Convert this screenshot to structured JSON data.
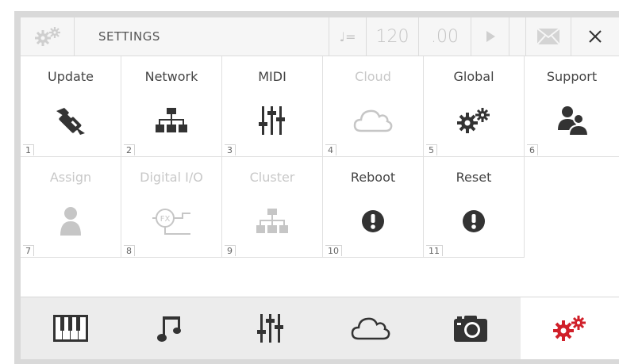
{
  "header": {
    "title": "SETTINGS",
    "tempo_prefix": "♩=",
    "tempo_value": "120",
    "tempo_decimal": ".00"
  },
  "tiles": [
    {
      "label": "Update",
      "num": "1",
      "icon": "wrench-icon",
      "enabled": true
    },
    {
      "label": "Network",
      "num": "2",
      "icon": "network-icon",
      "enabled": true
    },
    {
      "label": "MIDI",
      "num": "3",
      "icon": "sliders-icon",
      "enabled": true
    },
    {
      "label": "Cloud",
      "num": "4",
      "icon": "cloud-icon",
      "enabled": false
    },
    {
      "label": "Global",
      "num": "5",
      "icon": "gears-icon",
      "enabled": true
    },
    {
      "label": "Support",
      "num": "6",
      "icon": "users-icon",
      "enabled": true
    },
    {
      "label": "Assign",
      "num": "7",
      "icon": "user-icon",
      "enabled": false
    },
    {
      "label": "Digital I/O",
      "num": "8",
      "icon": "fx-icon",
      "enabled": false
    },
    {
      "label": "Cluster",
      "num": "9",
      "icon": "network-icon",
      "enabled": false
    },
    {
      "label": "Reboot",
      "num": "10",
      "icon": "exclamation-icon",
      "enabled": true
    },
    {
      "label": "Reset",
      "num": "11",
      "icon": "exclamation-icon",
      "enabled": true
    }
  ],
  "bottom_nav": [
    {
      "icon": "piano-icon"
    },
    {
      "icon": "music-note-icon"
    },
    {
      "icon": "mixer-icon"
    },
    {
      "icon": "cloud-icon"
    },
    {
      "icon": "camera-icon"
    },
    {
      "icon": "gears-icon",
      "active": true,
      "color": "#d0202a"
    }
  ]
}
